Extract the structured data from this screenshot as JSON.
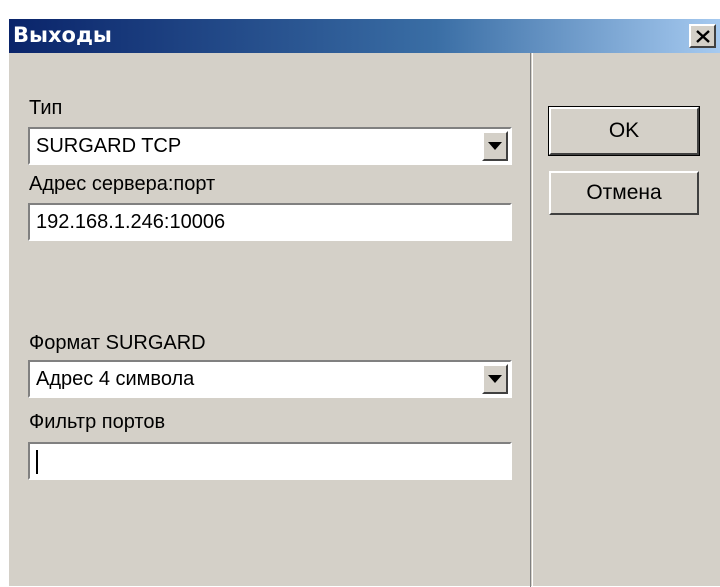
{
  "window": {
    "title": "Выходы",
    "close_glyph": "✕"
  },
  "form": {
    "type_label": "Тип",
    "type_value": "SURGARD TCP",
    "server_label": "Адрес сервера:порт",
    "server_value": "192.168.1.246:10006",
    "format_label": "Формат SURGARD",
    "format_value": "Адрес 4 символа",
    "filter_label": "Фильтр портов",
    "filter_value": ""
  },
  "buttons": {
    "ok_label": "OK",
    "cancel_label": "Отмена"
  },
  "icons": {
    "dropdown": "chevron-down-icon",
    "close": "close-icon"
  }
}
